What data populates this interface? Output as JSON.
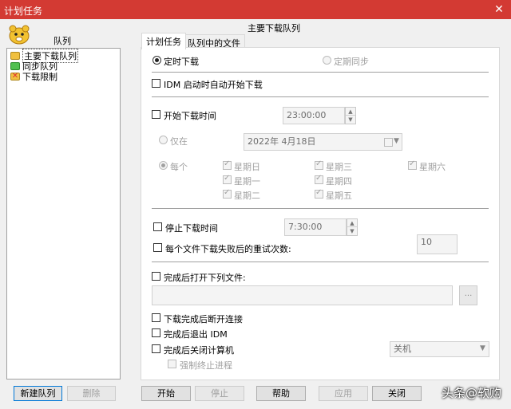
{
  "window": {
    "title": "计划任务",
    "close_glyph": "✕"
  },
  "left": {
    "header": "队列",
    "items": [
      {
        "label": "主要下载队列",
        "icon": "queue-folder-icon",
        "color": "#f0c040",
        "selected": true
      },
      {
        "label": "同步队列",
        "icon": "sync-queue-icon",
        "color": "#40b040",
        "selected": false
      },
      {
        "label": "下载限制",
        "icon": "limit-x-icon",
        "color": "#e03030",
        "selected": false
      }
    ],
    "new_queue_button": "新建队列",
    "delete_button": "删除"
  },
  "main": {
    "queue_title": "主要下载队列",
    "tabs": [
      {
        "label": "计划任务",
        "active": true
      },
      {
        "label": "队列中的文件",
        "active": false
      }
    ],
    "radio_timed": "定时下载",
    "radio_periodic": "定期同步",
    "idm_start": "IDM 启动时自动开始下载",
    "start_time_label": "开始下载时间",
    "start_time_value": "23:00:00",
    "only_on_label": "仅在",
    "date_value": "2022年  4月18日",
    "every_label": "每个",
    "weekdays": {
      "sun": "星期日",
      "mon": "星期一",
      "tue": "星期二",
      "wed": "星期三",
      "thu": "星期四",
      "fri": "星期五",
      "sat": "星期六"
    },
    "stop_time_label": "停止下载时间",
    "stop_time_value": "7:30:00",
    "retry_label": "每个文件下载失败后的重试次数:",
    "retry_value": "10",
    "open_file_label": "完成后打开下列文件:",
    "open_file_value": "",
    "browse_label": "...",
    "hangup_label": "下载完成后断开连接",
    "exit_idm_label": "完成后退出 IDM",
    "shutdown_label": "完成后关闭计算机",
    "shutdown_option": "关机",
    "force_kill_label": "强制终止进程"
  },
  "footer": {
    "start": "开始",
    "stop": "停止",
    "help": "帮助",
    "apply": "应用",
    "close": "关闭"
  },
  "watermark": "头条@软购"
}
